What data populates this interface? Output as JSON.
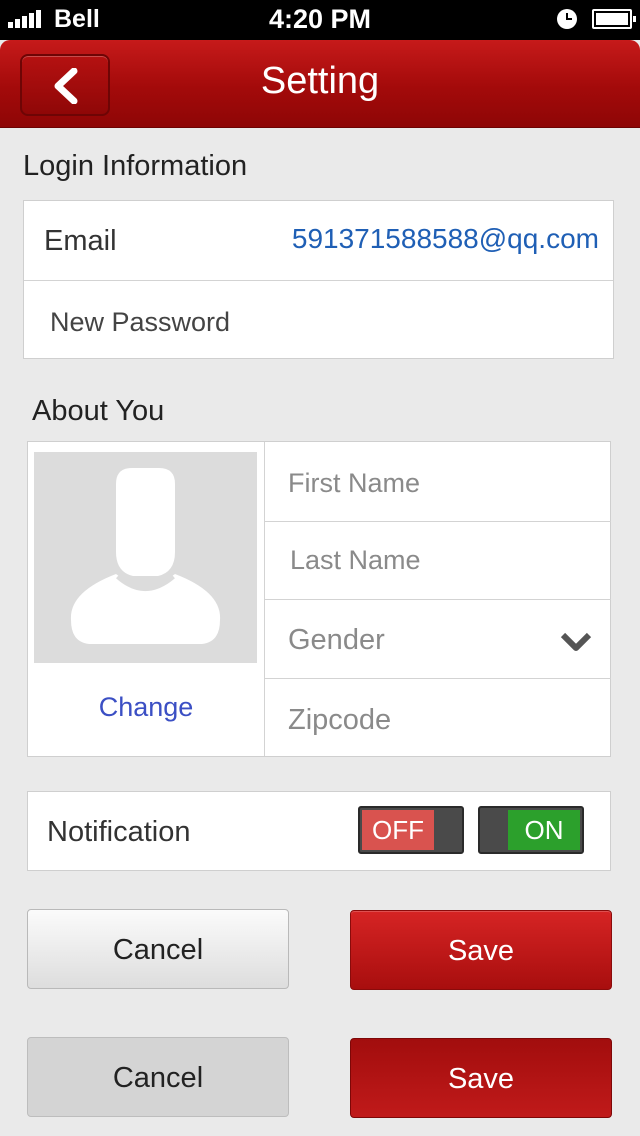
{
  "status_bar": {
    "carrier": "Bell",
    "time": "4:20 PM",
    "icons": [
      "signal-bars-icon",
      "clock-icon",
      "battery-icon"
    ]
  },
  "nav": {
    "back_icon": "chevron-left-icon",
    "title": "Setting"
  },
  "login": {
    "heading": "Login Information",
    "email_label": "Email",
    "email_value": "591371588588@qq.com",
    "password_placeholder": "New Password"
  },
  "about": {
    "heading": "About You",
    "avatar_icon": "user-silhouette-icon",
    "change_label": "Change",
    "first_name_placeholder": "First Name",
    "last_name_placeholder": "Last Name",
    "gender_placeholder": "Gender",
    "gender_icon": "chevron-down-icon",
    "zipcode_placeholder": "Zipcode"
  },
  "notification": {
    "label": "Notification",
    "off_label": "OFF",
    "on_label": "ON"
  },
  "buttons": {
    "cancel_label": "Cancel",
    "save_label": "Save"
  },
  "colors": {
    "nav_red": "#a30a0a",
    "email_blue": "#1f5fb5",
    "link_blue": "#3b4fc4",
    "toggle_off": "#d9534f",
    "toggle_on": "#2ca02c"
  }
}
